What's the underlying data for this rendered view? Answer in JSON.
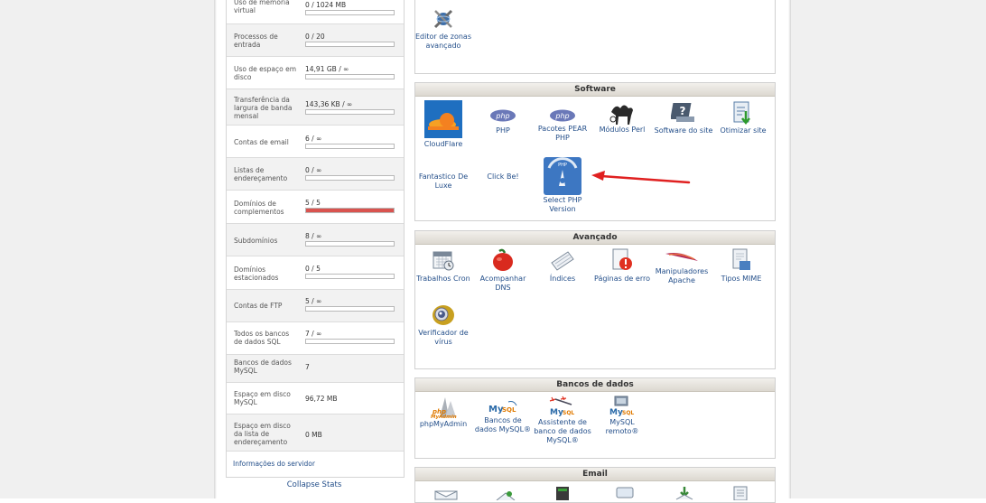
{
  "stats": [
    {
      "label": "Uso de memória virtual",
      "value": "0 / 1024 MB",
      "bar": 0
    },
    {
      "label": "Processos de entrada",
      "value": "0 / 20",
      "bar": 0
    },
    {
      "label": "Uso de espaço em disco",
      "value": "14,91 GB / ∞",
      "bar": 0
    },
    {
      "label": "Transferência da largura de banda mensal",
      "value": "143,36 KB / ∞",
      "bar": 0
    },
    {
      "label": "Contas de email",
      "value": "6 / ∞",
      "bar": 0
    },
    {
      "label": "Listas de endereçamento",
      "value": "0 / ∞",
      "bar": 0
    },
    {
      "label": "Domínios de complementos",
      "value": "5 / 5",
      "bar": 1.0
    },
    {
      "label": "Subdomínios",
      "value": "8 / ∞",
      "bar": 0
    },
    {
      "label": "Domínios estacionados",
      "value": "0 / 5",
      "bar": 0
    },
    {
      "label": "Contas de FTP",
      "value": "5 / ∞",
      "bar": 0
    },
    {
      "label": "Todos os bancos de dados SQL",
      "value": "7 / ∞",
      "bar": 0
    },
    {
      "label": "Bancos de dados MySQL",
      "value": "7"
    },
    {
      "label": "Espaço em disco MySQL",
      "value": "96,72 MB"
    },
    {
      "label": "Espaço em disco da lista de endereçamento",
      "value": "0 MB"
    }
  ],
  "server_info": "Informações do servidor",
  "collapse_stats": "Collapse Stats",
  "top_panel": {
    "item": "Editor de zonas avançado"
  },
  "software": {
    "title": "Software",
    "items": [
      {
        "label": "CloudFlare",
        "icon": "cloudflare-icon"
      },
      {
        "label": "PHP",
        "icon": "php-icon"
      },
      {
        "label": "Pacotes PEAR PHP",
        "icon": "php-icon"
      },
      {
        "label": "Módulos Perl",
        "icon": "camel-icon"
      },
      {
        "label": "Software do site",
        "icon": "software-icon"
      },
      {
        "label": "Otimizar site",
        "icon": "optimize-icon"
      },
      {
        "label": "Fantastico De Luxe",
        "icon": ""
      },
      {
        "label": "Click Be!",
        "icon": ""
      },
      {
        "label": "Select PHP Version",
        "icon": "select-php-icon"
      }
    ]
  },
  "advanced": {
    "title": "Avançado",
    "items": [
      {
        "label": "Trabalhos Cron",
        "icon": "calendar-icon"
      },
      {
        "label": "Acompanhar DNS",
        "icon": "dns-icon"
      },
      {
        "label": "Índices",
        "icon": "index-icon"
      },
      {
        "label": "Páginas de erro",
        "icon": "error-page-icon"
      },
      {
        "label": "Manipuladores Apache",
        "icon": "apache-icon"
      },
      {
        "label": "Tipos MIME",
        "icon": "mime-icon"
      },
      {
        "label": "Verificador de vírus",
        "icon": "virus-scan-icon"
      }
    ]
  },
  "databases": {
    "title": "Bancos de dados",
    "items": [
      {
        "label": "phpMyAdmin",
        "icon": "phpmyadmin-icon"
      },
      {
        "label": "Bancos de dados MySQL®",
        "icon": "mysql-icon"
      },
      {
        "label": "Assistente de banco de dados MySQL®",
        "icon": "mysql-wizard-icon"
      },
      {
        "label": "MySQL remoto®",
        "icon": "mysql-remote-icon"
      }
    ]
  },
  "email": {
    "title": "Email"
  },
  "colors": {
    "accent_link": "#244f8a",
    "bar_full": "#d9534f",
    "arrow": "#e02020"
  }
}
